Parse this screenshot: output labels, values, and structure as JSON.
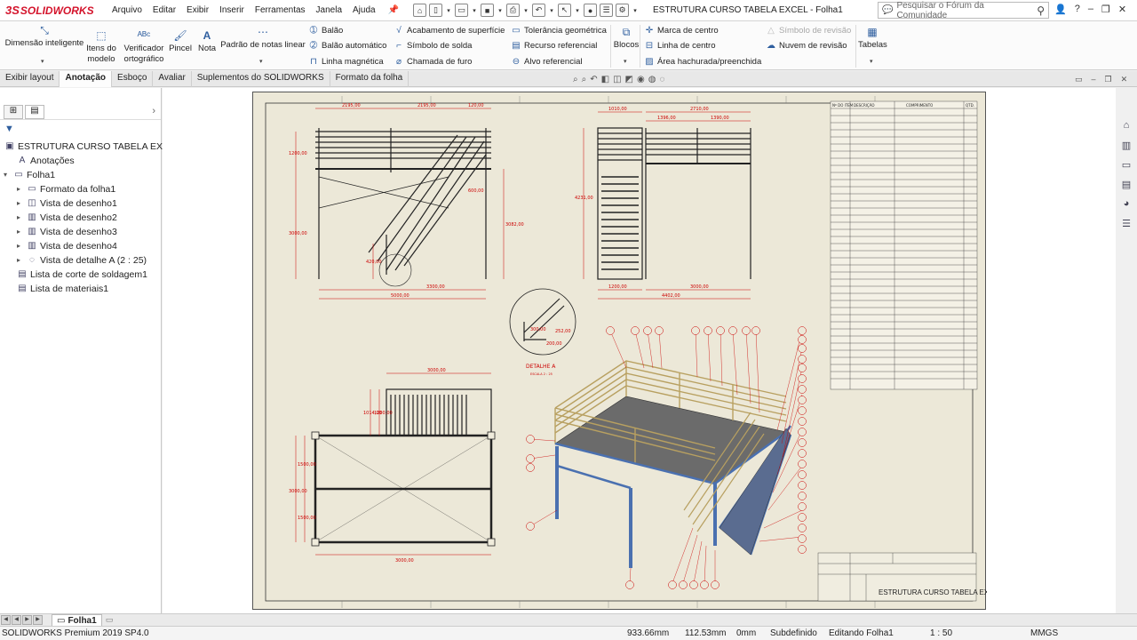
{
  "app": {
    "brand_ds": "3S",
    "brand_name": "SOLIDWORKS",
    "doc_title": "ESTRUTURA CURSO TABELA EXCEL - Folha1"
  },
  "menu": [
    "Arquivo",
    "Editar",
    "Exibir",
    "Inserir",
    "Ferramentas",
    "Janela",
    "Ajuda"
  ],
  "search": {
    "placeholder": "Pesquisar o Fórum da Comunidade"
  },
  "ribbon": {
    "dimensao": "Dimensão inteligente",
    "itens_modelo_1": "Itens do",
    "itens_modelo_2": "modelo",
    "verificador_1": "Verificador",
    "verificador_2": "ortográfico",
    "pincel": "Pincel",
    "nota": "Nota",
    "padrao_notas": "Padrão de notas linear",
    "balao": "Balão",
    "balao_auto": "Balão automático",
    "linha_magnetica": "Linha magnética",
    "acabamento": "Acabamento de superfície",
    "simbolo_solda": "Símbolo de solda",
    "chamada_furo": "Chamada de furo",
    "tolerancia": "Tolerância geométrica",
    "recurso_ref": "Recurso referencial",
    "alvo_ref": "Alvo referencial",
    "blocos": "Blocos",
    "marca_centro": "Marca de centro",
    "linha_centro": "Linha de centro",
    "area_hachurada": "Área hachurada/preenchida",
    "simbolo_revisao": "Símbolo de revisão",
    "nuvem_revisao": "Nuvem de revisão",
    "tabelas": "Tabelas"
  },
  "tabs": [
    "Exibir layout",
    "Anotação",
    "Esboço",
    "Avaliar",
    "Suplementos do SOLIDWORKS",
    "Formato da folha"
  ],
  "tree": {
    "root": "ESTRUTURA CURSO TABELA EXCEL",
    "items": [
      "Anotações",
      "Folha1",
      "Formato da folha1",
      "Vista de desenho1",
      "Vista de desenho2",
      "Vista de desenho3",
      "Vista de desenho4",
      "Vista de detalhe A (2 : 25)",
      "Lista de corte de soldagem1",
      "Lista de materiais1"
    ]
  },
  "drawing": {
    "detail_label": "DETALHE A",
    "detail_scale": "ESCALA 2 : 25",
    "title_block_name": "ESTRUTURA CURSO TABELA EXCEL",
    "dims": {
      "d1": "2195,00",
      "d2": "2195,00",
      "d3": "120,00",
      "d4": "1200,00",
      "d5": "3000,00",
      "d6": "600,00",
      "d7": "3082,00",
      "d8": "3300,00",
      "d9": "5000,00",
      "d10": "420,00",
      "d11": "1010,00",
      "d12": "2710,00",
      "d13": "1396,00",
      "d14": "1390,00",
      "d15": "4231,00",
      "d16": "1200,00",
      "d17": "3000,00",
      "d18": "4402,00",
      "d19": "300,00",
      "d20": "200,00",
      "d21": "252,00",
      "d22": "3000,00",
      "d23": "1014,00",
      "d24": "1200,00",
      "d25": "3000,00",
      "d26": "1500,00",
      "d27": "1500,00",
      "d28": "3000,00"
    },
    "bom_headers": [
      "Nº DO ITEM",
      "DESCRIÇÃO",
      "COMPRIMENTO",
      "QTD."
    ]
  },
  "sheet_tabs": {
    "active": "Folha1"
  },
  "status": {
    "version": "SOLIDWORKS Premium 2019 SP4.0",
    "x": "933.66mm",
    "y": "112.53mm",
    "z": "0mm",
    "state": "Subdefinido",
    "editing": "Editando Folha1",
    "scale": "1 : 50",
    "units": "MMGS"
  }
}
